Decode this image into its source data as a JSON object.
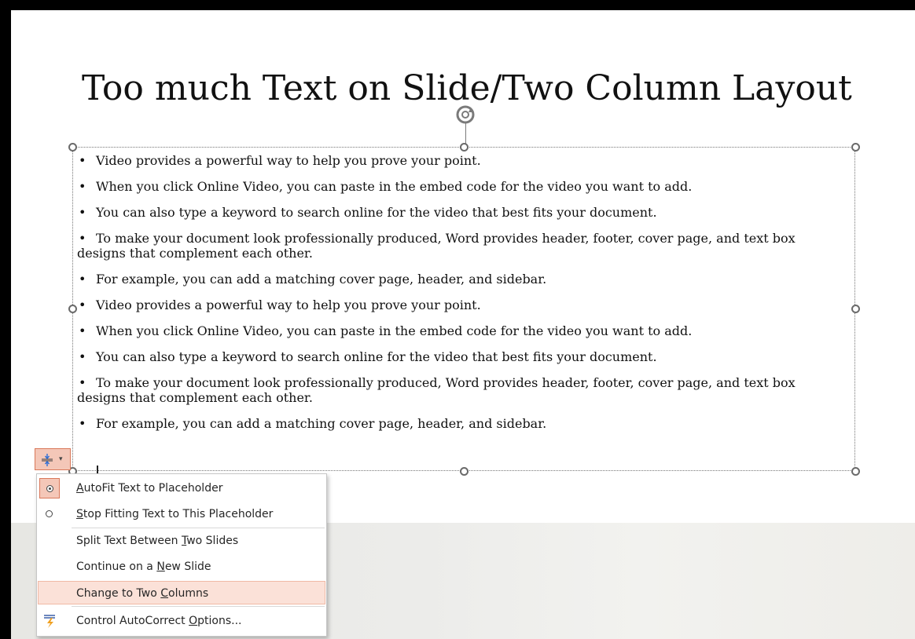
{
  "slide": {
    "title": "Too much Text on Slide/Two Column Layout",
    "bullets": [
      "Video provides a powerful way to help you prove your point.",
      "When you click Online Video, you can paste in the embed code for the video you want to add.",
      "You can also type a keyword to search online for the video that best fits your document.",
      "To make your document look professionally produced, Word provides header, footer, cover page, and text box designs that complement each other.",
      "For example, you can add a matching cover page, header, and sidebar.",
      "Video provides a powerful way to help you prove your point.",
      "When you click Online Video, you can paste in the embed code for the video you want to add.",
      "You can also type a keyword to search online for the video that best fits your document.",
      "To make your document look professionally produced, Word provides header, footer, cover page, and text box designs that complement each other.",
      "For example, you can add a matching cover page, header, and sidebar."
    ],
    "bullet_char": "•"
  },
  "autofit_menu": {
    "button_icon": "autofit-options-icon",
    "caret": "▾",
    "items": [
      {
        "pre": "",
        "key": "A",
        "post": "utoFit Text to Placeholder",
        "kind": "radio",
        "checked": true
      },
      {
        "pre": "",
        "key": "S",
        "post": "top Fitting Text to This Placeholder",
        "kind": "radio",
        "checked": false
      },
      {
        "pre": "Split Text Between ",
        "key": "T",
        "post": "wo Slides",
        "kind": "plain"
      },
      {
        "pre": "Continue on a ",
        "key": "N",
        "post": "ew Slide",
        "kind": "plain"
      },
      {
        "pre": "Change to Two ",
        "key": "C",
        "post": "olumns",
        "kind": "plain",
        "highlighted": true
      },
      {
        "pre": "Control AutoCorrect ",
        "key": "O",
        "post": "ptions...",
        "kind": "icon",
        "icon": "autocorrect-lightning-icon"
      }
    ]
  },
  "colors": {
    "accent_fill": "#f4c7b8",
    "accent_border": "#d9785a",
    "highlight_fill": "#fbe1d8"
  }
}
